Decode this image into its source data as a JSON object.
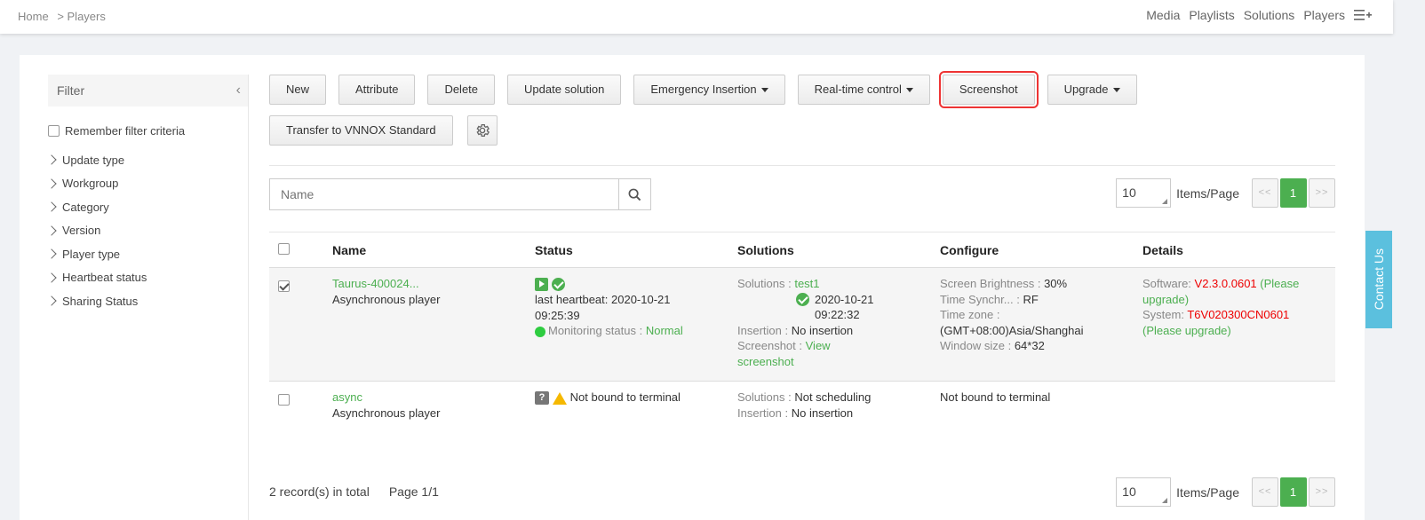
{
  "breadcrumb": {
    "home": "Home",
    "current": "> Players"
  },
  "topnav": {
    "items": [
      "Media",
      "Playlists",
      "Solutions",
      "Players"
    ]
  },
  "filter": {
    "title": "Filter",
    "remember_label": "Remember filter criteria",
    "items": [
      "Update type",
      "Workgroup",
      "Category",
      "Version",
      "Player type",
      "Heartbeat status",
      "Sharing Status"
    ]
  },
  "toolbar": {
    "new": "New",
    "attribute": "Attribute",
    "delete": "Delete",
    "update_solution": "Update solution",
    "emergency_insertion": "Emergency Insertion",
    "realtime_control": "Real-time control",
    "screenshot": "Screenshot",
    "upgrade": "Upgrade",
    "transfer": "Transfer to VNNOX Standard"
  },
  "search": {
    "placeholder": "Name"
  },
  "pagination": {
    "per_page": "10",
    "items_per_page": "Items/Page",
    "prev": "<<",
    "current": "1",
    "next": ">>"
  },
  "table": {
    "headers": [
      "Name",
      "Status",
      "Solutions",
      "Configure",
      "Details"
    ],
    "rows": [
      {
        "name": "Taurus-400024...",
        "type": "Asynchronous player",
        "status_heartbeat": "last heartbeat: 2020-10-21 09:25:39",
        "monitoring_label": "Monitoring status :",
        "monitoring_value": "Normal",
        "solutions_label": "Solutions :",
        "solutions_value": "test1",
        "solutions_time": "2020-10-21 09:22:32",
        "insertion_label": "Insertion :",
        "insertion_value": "No insertion",
        "screenshot_label": "Screenshot :",
        "screenshot_value": "View screenshot",
        "brightness_label": "Screen Brightness :",
        "brightness_value": "30%",
        "timesync_label": "Time Synchr... :",
        "timesync_value": "RF",
        "timezone_label": "Time zone :",
        "timezone_value": "(GMT+08:00)Asia/Shanghai",
        "window_label": "Window size :",
        "window_value": "64*32",
        "software_label": "Software:",
        "software_value": "V2.3.0.0601",
        "software_note": "(Please upgrade)",
        "system_label": "System:",
        "system_value": "T6V020300CN0601",
        "system_note": "(Please upgrade)"
      },
      {
        "name": "async",
        "type": "Asynchronous player",
        "status_text": "Not bound to terminal",
        "solutions_label": "Solutions :",
        "solutions_value": "Not scheduling",
        "insertion_label": "Insertion :",
        "insertion_value": "No insertion",
        "configure_text": "Not bound to terminal"
      }
    ]
  },
  "footer": {
    "total": "2 record(s) in total",
    "page": "Page 1/1"
  },
  "contact": "Contact Us",
  "colors": {
    "accent_green": "#4caf50",
    "highlight_red": "#e33",
    "contact_blue": "#5bc0de"
  }
}
